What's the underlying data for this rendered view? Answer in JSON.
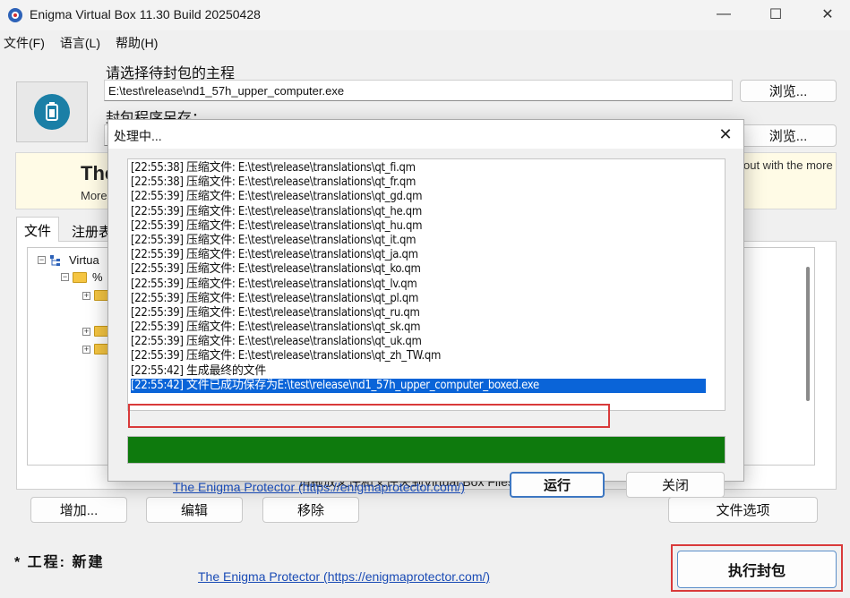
{
  "window": {
    "title": "Enigma Virtual Box 11.30 Build 20250428",
    "minimize": "—",
    "maximize": "☐",
    "close": "✕"
  },
  "menu": [
    "文件(F)",
    "语言(L)",
    "帮助(H)"
  ],
  "main": {
    "label_main": "请选择待封包的主程",
    "input_main": "E:\\test\\release\\nd1_57h_upper_computer.exe",
    "label_save": "封包程序另存：",
    "input_save": "",
    "browse": "浏览...",
    "banner_title": "The",
    "banner_sub": "More",
    "banner_right": "out with the more",
    "tabs": [
      "文件",
      "注册表"
    ],
    "tree_root": "Virtua",
    "tree_child": "%",
    "drop_hint": "请拖放文件和文件夹到Virtual Box Files树内",
    "buttons": {
      "add": "增加...",
      "edit": "编辑",
      "remove": "移除",
      "file_options": "文件选项",
      "process": "执行封包"
    },
    "project_status": "* 工程: 新建",
    "footer_link": "The Enigma Protector (https://enigmaprotector.com/)"
  },
  "dialog": {
    "title": "处理中...",
    "close": "✕",
    "log": [
      "[22:55:38] 压缩文件: E:\\test\\release\\translations\\qt_fi.qm",
      "[22:55:38] 压缩文件: E:\\test\\release\\translations\\qt_fr.qm",
      "[22:55:39] 压缩文件: E:\\test\\release\\translations\\qt_gd.qm",
      "[22:55:39] 压缩文件: E:\\test\\release\\translations\\qt_he.qm",
      "[22:55:39] 压缩文件: E:\\test\\release\\translations\\qt_hu.qm",
      "[22:55:39] 压缩文件: E:\\test\\release\\translations\\qt_it.qm",
      "[22:55:39] 压缩文件: E:\\test\\release\\translations\\qt_ja.qm",
      "[22:55:39] 压缩文件: E:\\test\\release\\translations\\qt_ko.qm",
      "[22:55:39] 压缩文件: E:\\test\\release\\translations\\qt_lv.qm",
      "[22:55:39] 压缩文件: E:\\test\\release\\translations\\qt_pl.qm",
      "[22:55:39] 压缩文件: E:\\test\\release\\translations\\qt_ru.qm",
      "[22:55:39] 压缩文件: E:\\test\\release\\translations\\qt_sk.qm",
      "[22:55:39] 压缩文件: E:\\test\\release\\translations\\qt_uk.qm",
      "[22:55:39] 压缩文件: E:\\test\\release\\translations\\qt_zh_TW.qm",
      "[22:55:42] 生成最终的文件",
      "[22:55:42] 文件已成功保存为E:\\test\\release\\nd1_57h_upper_computer_boxed.exe"
    ],
    "selected_index": 15,
    "progress": 1.0,
    "progress_color": "#0e7a0d",
    "link": "The Enigma Protector (https://enigmaprotector.com/)",
    "run": "运行",
    "close_button": "关闭"
  },
  "colors": {
    "selection": "#0a64d8",
    "highlight_box": "#d93a3a",
    "link": "#1a4bb5",
    "logo": "#1b7fa6"
  }
}
